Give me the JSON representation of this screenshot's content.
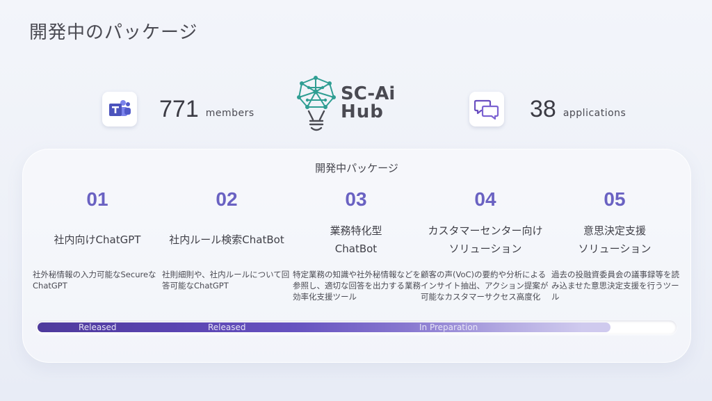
{
  "slide": {
    "title": "開発中のパッケージ"
  },
  "stats": {
    "members": {
      "icon": "teams-icon",
      "value": "771",
      "unit": "members"
    },
    "applications": {
      "icon": "chat-bubbles-icon",
      "value": "38",
      "unit": "applications"
    }
  },
  "logo": {
    "icon": "ai-lightbulb-icon",
    "line1": "SC-Ai",
    "line2": "Hub"
  },
  "panel": {
    "title": "開発中パッケージ",
    "packages": [
      {
        "number": "01",
        "name": "社内向けChatGPT",
        "description": "社外秘情報の入力可能なSecureなChatGPT"
      },
      {
        "number": "02",
        "name": "社内ルール検索ChatBot",
        "description": "社則細則や、社内ルールについて回答可能なChatGPT"
      },
      {
        "number": "03",
        "name": "業務特化型\nChatBot",
        "description": "特定業務の知識や社外秘情報などを参照し、適切な回答を出力する業務効率化支援ツール"
      },
      {
        "number": "04",
        "name": "カスタマーセンター向け\nソリューション",
        "description": "顧客の声(VoC)の要約や分析によるインサイト抽出、アクション提案が可能なカスタマーサクセス高度化"
      },
      {
        "number": "05",
        "name": "意思決定支援\nソリューション",
        "description": "過去の投融資委員会の議事録等を読み込ませた意思決定支援を行うツール"
      }
    ],
    "progress": {
      "fill_fraction": 0.9,
      "labels": [
        "Released",
        "Released",
        "In Preparation"
      ]
    }
  },
  "colors": {
    "accent": "#6a62c2",
    "progress_dark": "#4e3a9c",
    "progress_light": "#cfcaee"
  }
}
